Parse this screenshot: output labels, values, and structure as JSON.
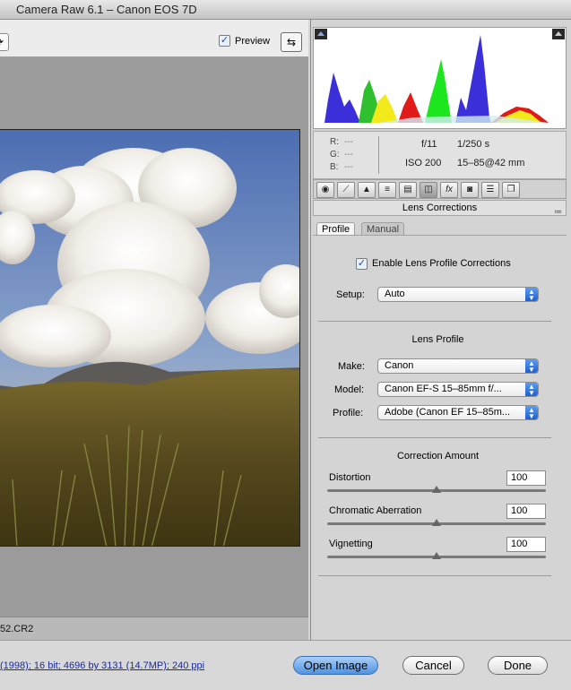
{
  "window": {
    "title": "Camera Raw 6.1  –  Canon EOS 7D"
  },
  "preview": {
    "label": "Preview",
    "checked": true
  },
  "filename": "52.CR2",
  "readout": {
    "r_label": "R:",
    "g_label": "G:",
    "b_label": "B:",
    "r_val": "---",
    "g_val": "---",
    "b_val": "---",
    "aperture": "f/11",
    "shutter": "1/250 s",
    "iso": "ISO 200",
    "lens": "15–85@42 mm"
  },
  "panel": {
    "title": "Lens Corrections",
    "tabs": {
      "profile": "Profile",
      "manual": "Manual"
    },
    "enable_label": "Enable Lens Profile Corrections",
    "setup_label": "Setup:",
    "setup_value": "Auto",
    "lens_profile_title": "Lens Profile",
    "make_label": "Make:",
    "make_value": "Canon",
    "model_label": "Model:",
    "model_value": "Canon EF-S 15–85mm f/...",
    "profile_label": "Profile:",
    "profile_value": "Adobe (Canon EF 15–85m...",
    "correction_title": "Correction Amount",
    "distortion_label": "Distortion",
    "distortion_value": "100",
    "ca_label": "Chromatic Aberration",
    "ca_value": "100",
    "vignetting_label": "Vignetting",
    "vignetting_value": "100",
    "slider_fraction": 0.5
  },
  "status": {
    "link_text": "(1998); 16 bit; 4696 by 3131 (14.7MP); 240 ppi"
  },
  "buttons": {
    "open": "Open Image",
    "cancel": "Cancel",
    "done": "Done"
  },
  "colors": {
    "accent": "#3a7ee4",
    "link": "#1c2a9a"
  }
}
